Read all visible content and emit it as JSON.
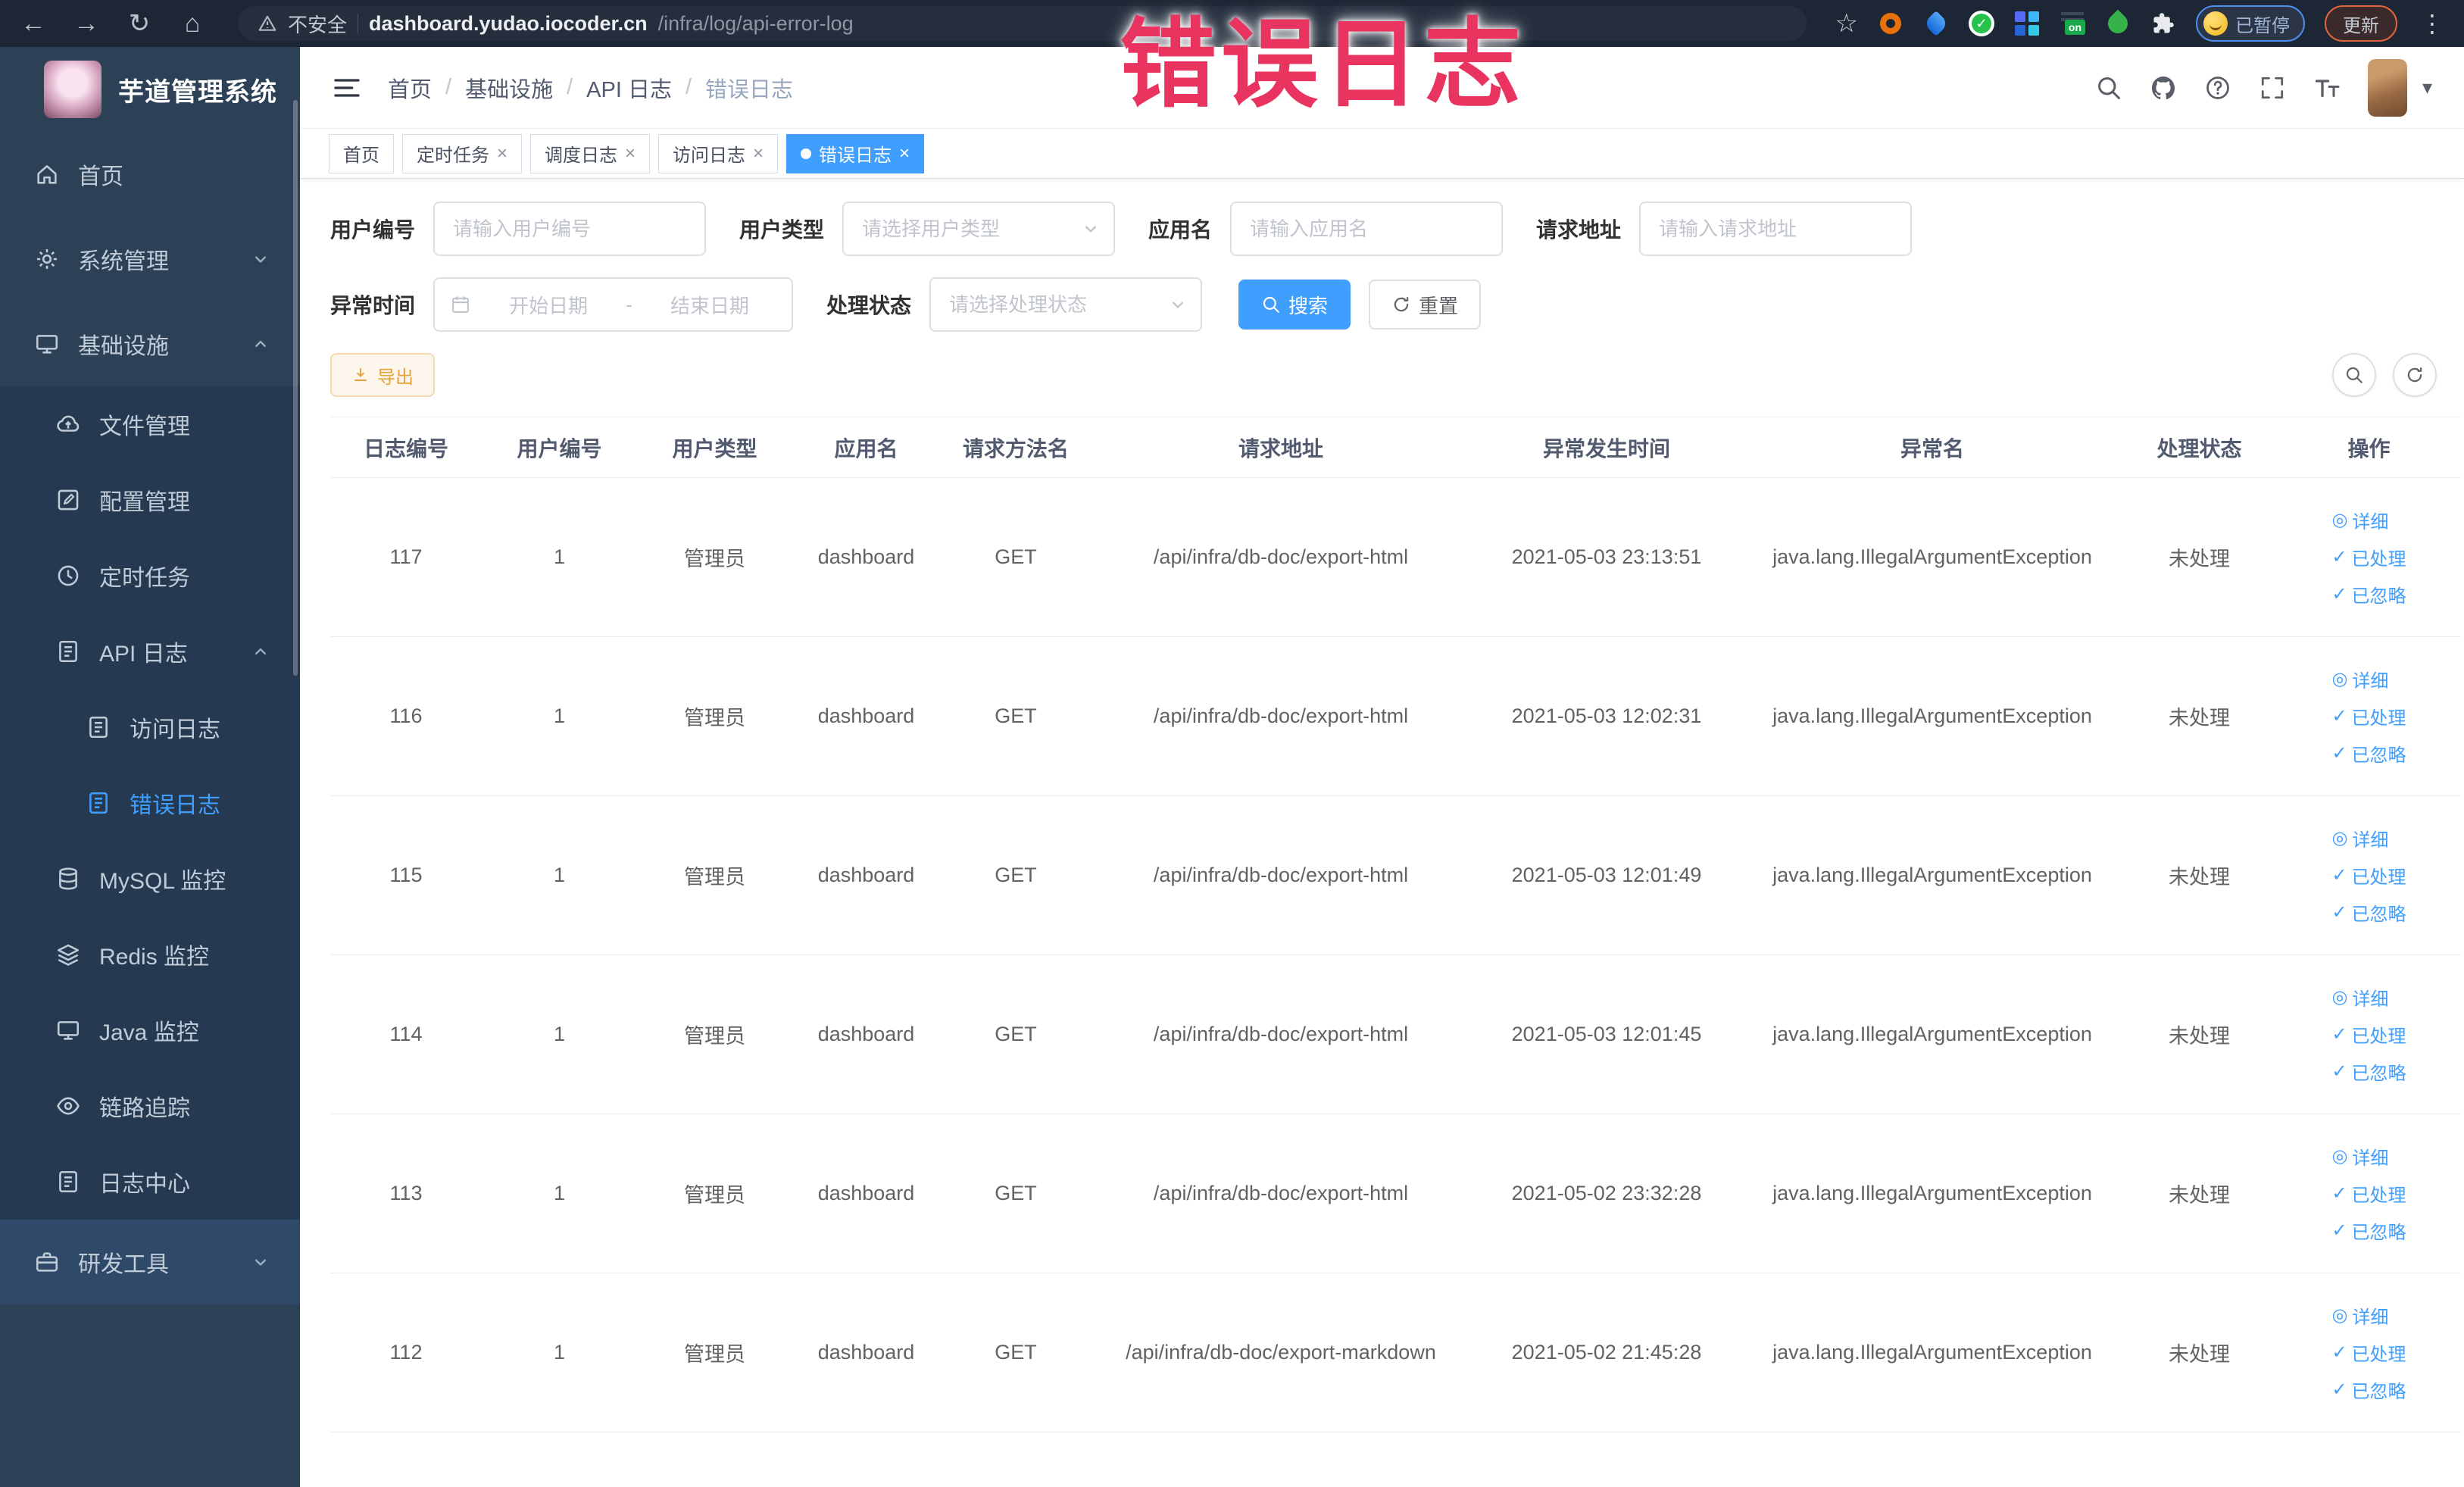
{
  "colors": {
    "accent": "#409eff",
    "annotation_red": "#e8345f",
    "warning": "#e6a23c",
    "sidebar_bg": "#2d4156"
  },
  "icons": {
    "back": "←",
    "forward": "→",
    "reload": "↻",
    "home": "⌂",
    "star": "☆",
    "ellipsis": "⋮",
    "caret": "▾",
    "close": "×",
    "detail_glyph": "◎",
    "check_glyph": "✓",
    "on_badge": "on",
    "ext_check": "✓"
  },
  "browser": {
    "security_label": "不安全",
    "url_host": "dashboard.yudao.iocoder.cn",
    "url_path": "/infra/log/api-error-log",
    "profile_badge": "已暂停",
    "update_label": "更新"
  },
  "annotation": {
    "text": "错误日志"
  },
  "sidebar": {
    "title": "芋道管理系统",
    "items": [
      {
        "label": "首页"
      },
      {
        "label": "系统管理"
      },
      {
        "label": "基础设施"
      },
      {
        "label": "文件管理"
      },
      {
        "label": "配置管理"
      },
      {
        "label": "定时任务"
      },
      {
        "label": "API 日志"
      },
      {
        "label": "访问日志"
      },
      {
        "label": "错误日志"
      },
      {
        "label": "MySQL 监控"
      },
      {
        "label": "Redis 监控"
      },
      {
        "label": "Java 监控"
      },
      {
        "label": "链路追踪"
      },
      {
        "label": "日志中心"
      },
      {
        "label": "研发工具"
      }
    ]
  },
  "breadcrumb": {
    "sep": "/",
    "items": [
      "首页",
      "基础设施",
      "API 日志",
      "错误日志"
    ]
  },
  "tabs": [
    {
      "label": "首页"
    },
    {
      "label": "定时任务"
    },
    {
      "label": "调度日志"
    },
    {
      "label": "访问日志"
    },
    {
      "label": "错误日志"
    }
  ],
  "filters": {
    "user_id": {
      "label": "用户编号",
      "placeholder": "请输入用户编号"
    },
    "user_type": {
      "label": "用户类型",
      "placeholder": "请选择用户类型"
    },
    "app_name": {
      "label": "应用名",
      "placeholder": "请输入应用名"
    },
    "request_url": {
      "label": "请求地址",
      "placeholder": "请输入请求地址"
    },
    "exception_time": {
      "label": "异常时间",
      "start_placeholder": "开始日期",
      "separator": "-",
      "end_placeholder": "结束日期"
    },
    "process_status": {
      "label": "处理状态",
      "placeholder": "请选择处理状态"
    },
    "search_label": "搜索",
    "reset_label": "重置"
  },
  "toolbar": {
    "export_label": "导出"
  },
  "table": {
    "columns": [
      "日志编号",
      "用户编号",
      "用户类型",
      "应用名",
      "请求方法名",
      "请求地址",
      "异常发生时间",
      "异常名",
      "处理状态",
      "操作"
    ],
    "action_labels": [
      "详细",
      "已处理",
      "已忽略"
    ],
    "rows": [
      {
        "id": "117",
        "user_id": "1",
        "user_type": "管理员",
        "app": "dashboard",
        "method": "GET",
        "url": "/api/infra/db-doc/export-html",
        "time": "2021-05-03 23:13:51",
        "exception": "java.lang.IllegalArgumentException",
        "status": "未处理"
      },
      {
        "id": "116",
        "user_id": "1",
        "user_type": "管理员",
        "app": "dashboard",
        "method": "GET",
        "url": "/api/infra/db-doc/export-html",
        "time": "2021-05-03 12:02:31",
        "exception": "java.lang.IllegalArgumentException",
        "status": "未处理"
      },
      {
        "id": "115",
        "user_id": "1",
        "user_type": "管理员",
        "app": "dashboard",
        "method": "GET",
        "url": "/api/infra/db-doc/export-html",
        "time": "2021-05-03 12:01:49",
        "exception": "java.lang.IllegalArgumentException",
        "status": "未处理"
      },
      {
        "id": "114",
        "user_id": "1",
        "user_type": "管理员",
        "app": "dashboard",
        "method": "GET",
        "url": "/api/infra/db-doc/export-html",
        "time": "2021-05-03 12:01:45",
        "exception": "java.lang.IllegalArgumentException",
        "status": "未处理"
      },
      {
        "id": "113",
        "user_id": "1",
        "user_type": "管理员",
        "app": "dashboard",
        "method": "GET",
        "url": "/api/infra/db-doc/export-html",
        "time": "2021-05-02 23:32:28",
        "exception": "java.lang.IllegalArgumentException",
        "status": "未处理"
      },
      {
        "id": "112",
        "user_id": "1",
        "user_type": "管理员",
        "app": "dashboard",
        "method": "GET",
        "url": "/api/infra/db-doc/export-markdown",
        "time": "2021-05-02 21:45:28",
        "exception": "java.lang.IllegalArgumentException",
        "status": "未处理"
      }
    ]
  }
}
